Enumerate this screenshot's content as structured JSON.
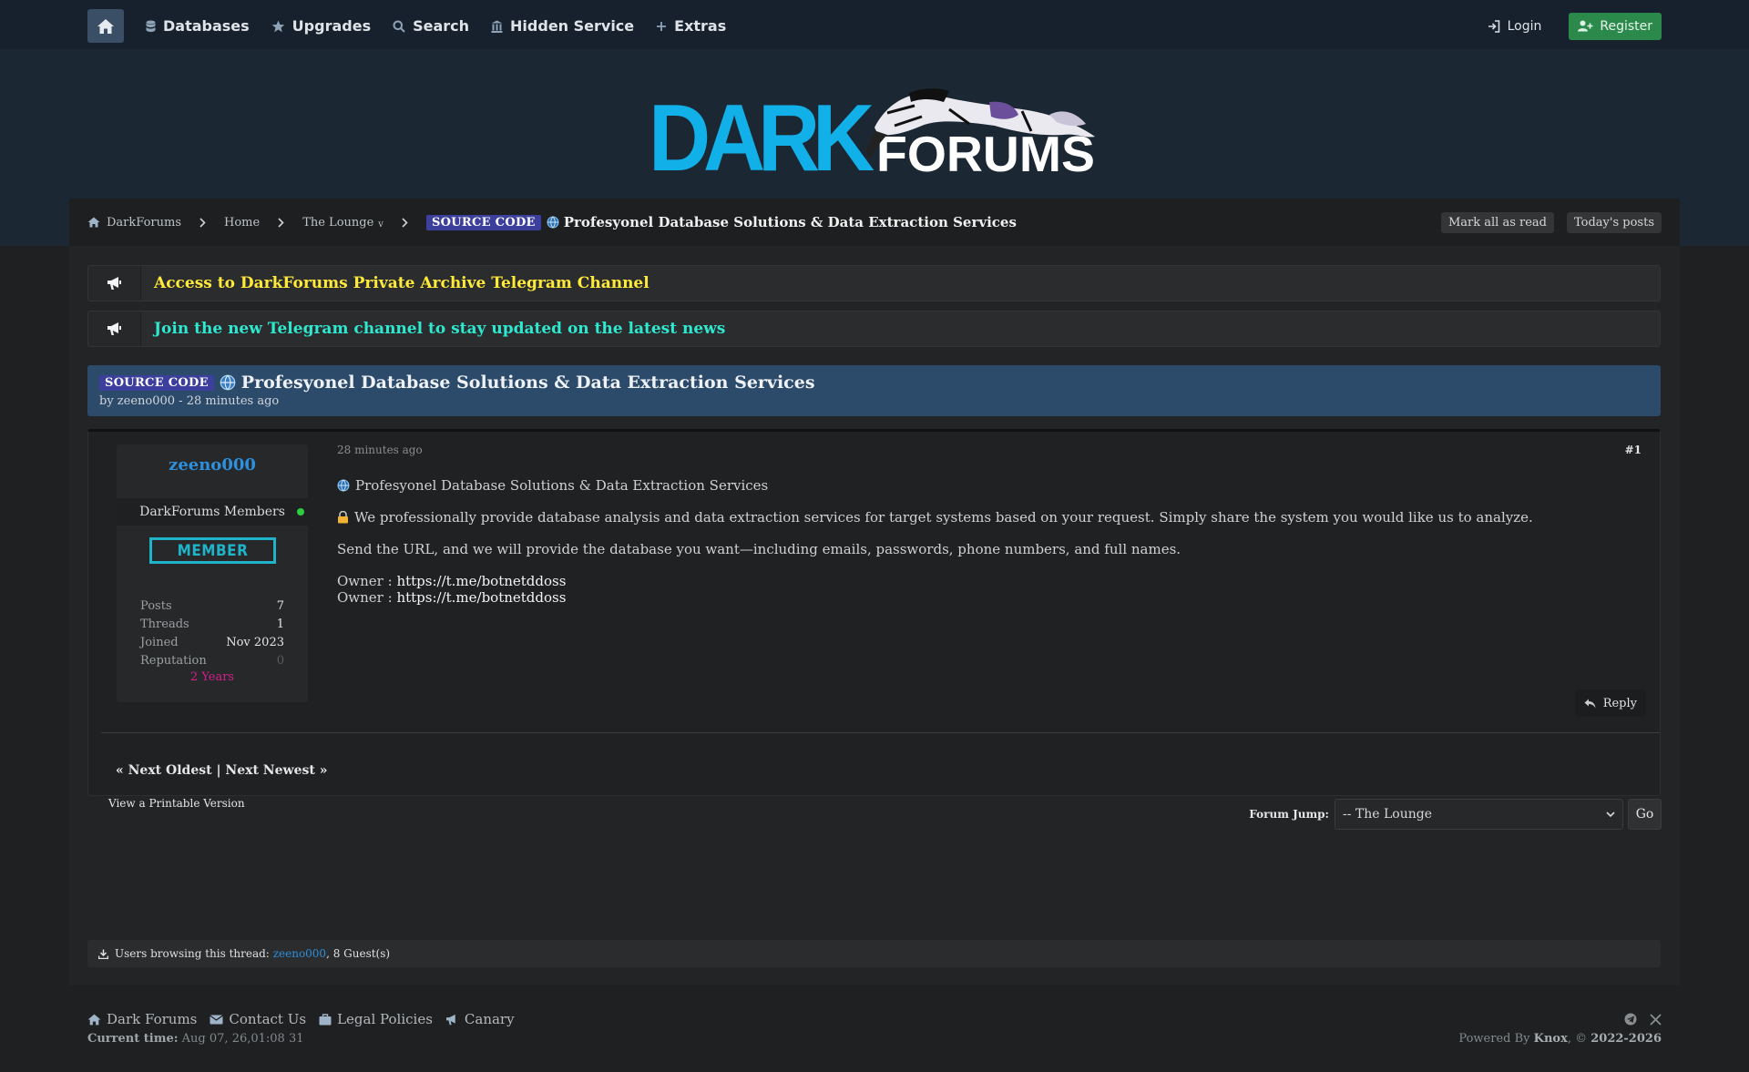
{
  "nav": {
    "items": [
      {
        "label": "Databases",
        "icon": "database-icon"
      },
      {
        "label": "Upgrades",
        "icon": "star-icon"
      },
      {
        "label": "Search",
        "icon": "search-icon"
      },
      {
        "label": "Hidden Service",
        "icon": "building-icon"
      },
      {
        "label": "Extras",
        "icon": "plus-icon"
      }
    ],
    "login": "Login",
    "register": "Register"
  },
  "logo": {
    "dark": "DARK",
    "forums": "FORUMS"
  },
  "breadcrumb": {
    "items": [
      "DarkForums",
      "Home",
      "The Lounge"
    ],
    "lounge_caret": "v",
    "badge": "SOURCE CODE",
    "title": "Profesyonel Database Solutions & Data Extraction Services",
    "mark_read": "Mark all as read",
    "todays_posts": "Today's posts"
  },
  "announcements": [
    {
      "text": "Access to DarkForums Private Archive Telegram Channel",
      "color": "#ffe93a"
    },
    {
      "text": "Join the new Telegram channel to stay updated on the latest news",
      "color": "#2ee8d0"
    }
  ],
  "thread": {
    "badge": "SOURCE CODE",
    "title": "Profesyonel Database Solutions & Data Extraction Services",
    "byline": "by zeeno000 - 28 minutes ago"
  },
  "author": {
    "name": "zeeno000",
    "group": "DarkForums Members",
    "rank": "MEMBER",
    "stats": [
      {
        "k": "Posts",
        "v": "7"
      },
      {
        "k": "Threads",
        "v": "1"
      },
      {
        "k": "Joined",
        "v": "Nov 2023"
      },
      {
        "k": "Reputation",
        "v": "0"
      }
    ],
    "years": "2 Years"
  },
  "post": {
    "date": "28 minutes ago",
    "number": "#1",
    "line1": "Profesyonel Database Solutions & Data Extraction Services",
    "line2": "We professionally provide database analysis and data extraction services for target systems based on your request. Simply share the system you would like us to analyze.",
    "line3": "Send the URL, and we will provide the database you want—including emails, passwords, phone numbers, and full names.",
    "owner_label": "Owner :",
    "owner_link": "https://t.me/botnetddoss",
    "reply": "Reply",
    "nav": "« Next Oldest | Next Newest »"
  },
  "printable": "View a Printable Version",
  "forum_jump": {
    "label": "Forum Jump:",
    "selected": "-- The Lounge",
    "go": "Go"
  },
  "browsing": {
    "prefix": "Users browsing this thread:",
    "user": "zeeno000",
    "suffix": ", 8 Guest(s)"
  },
  "footer": {
    "links": [
      {
        "label": "Dark Forums",
        "icon": "home-icon"
      },
      {
        "label": "Contact Us",
        "icon": "envelope-icon"
      },
      {
        "label": "Legal Policies",
        "icon": "briefcase-icon"
      },
      {
        "label": "Canary",
        "icon": "megaphone-icon"
      }
    ],
    "time_label": "Current time:",
    "time_value": "Aug 07, 26,01:08 31",
    "powered_prefix": "Powered By",
    "powered_name": "Knox",
    "powered_suffix": ", ©",
    "powered_years": "2022-2026"
  }
}
